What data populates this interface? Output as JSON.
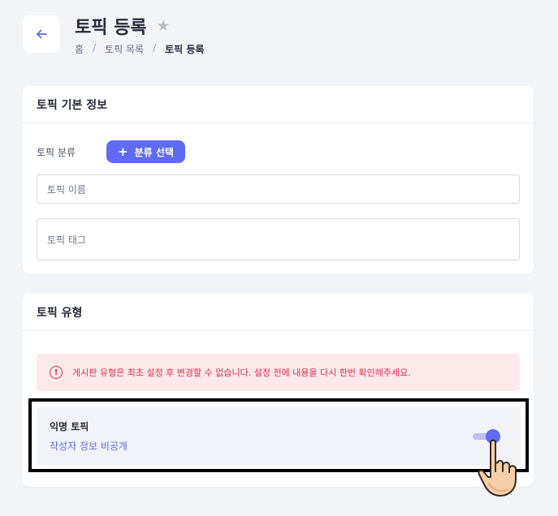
{
  "header": {
    "title": "토픽 등록",
    "star_icon": "star-icon",
    "breadcrumb": [
      "홈",
      "토픽 목록",
      "토픽 등록"
    ],
    "breadcrumb_sep": "/"
  },
  "basic_info": {
    "heading": "토픽 기본 정보",
    "category_label": "토픽 분류",
    "category_button": "분류 선택",
    "name_placeholder": "토픽 이름",
    "tag_placeholder": "토픽 태그"
  },
  "topic_type": {
    "heading": "토픽 유형",
    "alert_icon": "!",
    "alert_text": "게시판 유형은 최초 설정 후 변경할 수 없습니다. 설정 전에 내용을 다시 한번 확인해주세요.",
    "anonymous_title": "익명 토픽",
    "anonymous_sub": "작성자 정보 비공개",
    "anonymous_enabled": true
  },
  "colors": {
    "accent": "#5e6bf2",
    "alert_bg": "#fde8ea",
    "alert_text": "#e0304d",
    "page_bg": "#f3f4f8"
  }
}
